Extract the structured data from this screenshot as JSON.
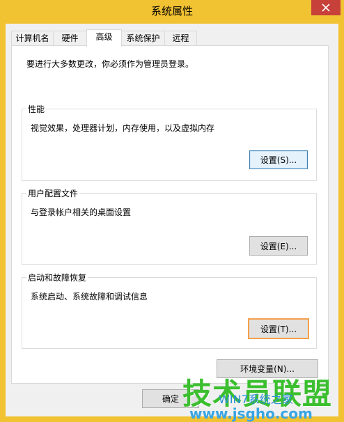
{
  "window": {
    "title": "系统属性",
    "close_icon": "close-icon",
    "accent": "#f1c232",
    "close_color": "#c7403a"
  },
  "tabs": [
    {
      "label": "计算机名"
    },
    {
      "label": "硬件"
    },
    {
      "label": "高级",
      "active": true
    },
    {
      "label": "系统保护"
    },
    {
      "label": "远程"
    }
  ],
  "advanced": {
    "admin_note": "要进行大多数更改，你必须作为管理员登录。",
    "performance": {
      "title": "性能",
      "description": "视觉效果，处理器计划，内存使用，以及虚拟内存",
      "settings_label": "设置(S)..."
    },
    "user_profiles": {
      "title": "用户配置文件",
      "description": "与登录帐户相关的桌面设置",
      "settings_label": "设置(E)..."
    },
    "startup_recovery": {
      "title": "启动和故障恢复",
      "description": "系统启动、系统故障和调试信息",
      "settings_label": "设置(T)..."
    },
    "env_vars_label": "环境变量(N)..."
  },
  "footer": {
    "ok_label": "确定"
  },
  "watermark": {
    "brand": "技术员联盟",
    "sub": "WIN7系统之家",
    "url": "www.jsgho.com"
  }
}
